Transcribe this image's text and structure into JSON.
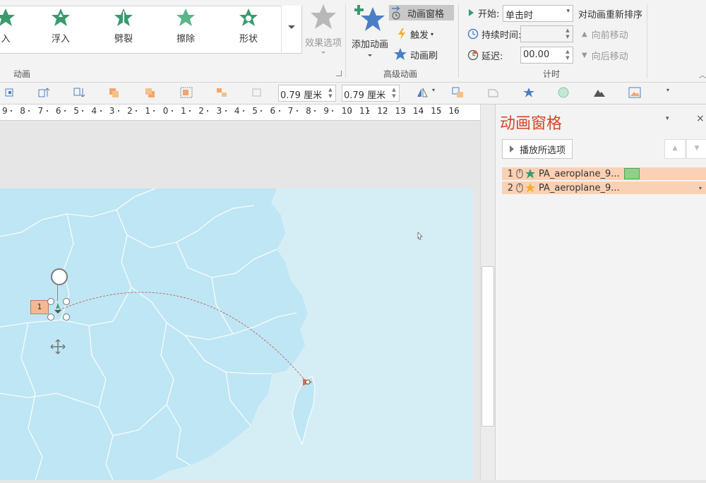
{
  "ribbon": {
    "gallery": [
      "入",
      "浮入",
      "劈裂",
      "擦除",
      "形状"
    ],
    "effect_options_label": "效果选项",
    "group_animation": "动画",
    "add_animation_label": "添加动画",
    "animation_pane_label": "动画窗格",
    "trigger_label": "触发",
    "animation_painter_label": "动画刷",
    "group_advanced": "高级动画",
    "start_label": "开始:",
    "start_value": "单击时",
    "duration_label": "持续时间:",
    "duration_value": "",
    "delay_label": "延迟:",
    "delay_value": "00.00",
    "reorder_label": "对动画重新排序",
    "move_earlier_label": "向前移动",
    "move_later_label": "向后移动",
    "group_timing": "计时"
  },
  "toolbar": {
    "height_value": "0.79 厘米",
    "width_value": "0.79 厘米"
  },
  "ruler": {
    "ticks": [
      "9",
      "8",
      "7",
      "6",
      "5",
      "4",
      "3",
      "2",
      "1",
      "0",
      "1",
      "2",
      "3",
      "4",
      "5",
      "6",
      "7",
      "8",
      "9",
      "10",
      "11",
      "12",
      "13",
      "14",
      "15",
      "16"
    ]
  },
  "slide": {
    "selected_tag": "1"
  },
  "pane": {
    "title": "动画窗格",
    "play_label": "播放所选项",
    "items": [
      {
        "index": "1",
        "name": "PA_aeroplane_9..."
      },
      {
        "index": "2",
        "name": "PA_aeroplane_9..."
      }
    ]
  },
  "colors": {
    "accent_title": "#d24726",
    "list_highlight": "#fbd1b5",
    "map_sea": "#d5eef6",
    "map_land": "#bfe6f4",
    "timing_bar": "#8fd18a"
  }
}
